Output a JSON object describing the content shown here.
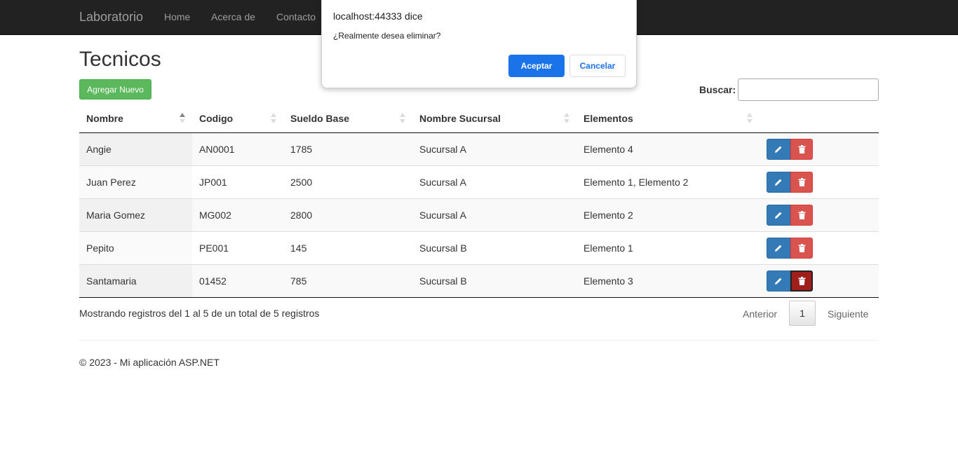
{
  "navbar": {
    "brand": "Laboratorio",
    "links": [
      "Home",
      "Acerca de",
      "Contacto"
    ]
  },
  "page": {
    "title": "Tecnicos",
    "add_button": "Agregar Nuevo",
    "search_label": "Buscar:",
    "search_value": ""
  },
  "table": {
    "columns": [
      "Nombre",
      "Codigo",
      "Sueldo Base",
      "Nombre Sucursal",
      "Elementos"
    ],
    "sorted_column": "Nombre",
    "sort_direction": "asc",
    "rows": [
      {
        "nombre": "Angie",
        "codigo": "AN0001",
        "sueldo": "1785",
        "sucursal": "Sucursal A",
        "elementos": "Elemento 4"
      },
      {
        "nombre": "Juan Perez",
        "codigo": "JP001",
        "sueldo": "2500",
        "sucursal": "Sucursal A",
        "elementos": "Elemento 1, Elemento 2"
      },
      {
        "nombre": "Maria Gomez",
        "codigo": "MG002",
        "sueldo": "2800",
        "sucursal": "Sucursal A",
        "elementos": "Elemento 2"
      },
      {
        "nombre": "Pepito",
        "codigo": "PE001",
        "sueldo": "145",
        "sucursal": "Sucursal B",
        "elementos": "Elemento 1"
      },
      {
        "nombre": "Santamaria",
        "codigo": "01452",
        "sueldo": "785",
        "sucursal": "Sucursal B",
        "elementos": "Elemento 3"
      }
    ],
    "row_actions": {
      "edit_icon": "pencil-icon",
      "delete_icon": "trash-icon"
    }
  },
  "pagination": {
    "info": "Mostrando registros del 1 al 5 de un total de 5 registros",
    "previous": "Anterior",
    "current_page": "1",
    "next": "Siguiente"
  },
  "footer": {
    "text": "© 2023 - Mi aplicación ASP.NET"
  },
  "dialog": {
    "title": "localhost:44333 dice",
    "message": "¿Realmente desea eliminar?",
    "ok_label": "Aceptar",
    "cancel_label": "Cancelar"
  },
  "colors": {
    "navbar": "#222222",
    "success": "#5cb85c",
    "primary": "#337ab7",
    "danger": "#d9534f",
    "dialog_accent": "#1a73e8"
  }
}
